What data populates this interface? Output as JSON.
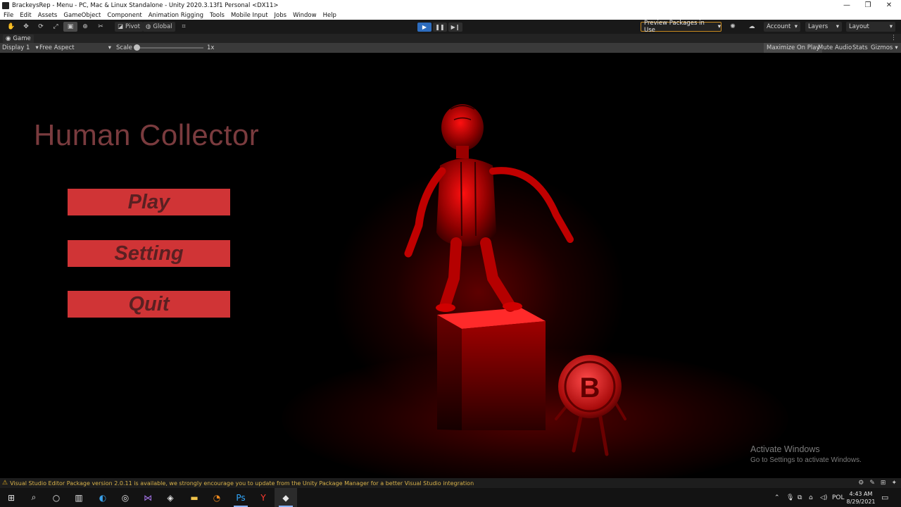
{
  "window": {
    "title": "BrackeysRep - Menu - PC, Mac & Linux Standalone - Unity 2020.3.13f1 Personal <DX11>",
    "minimize_glyph": "—",
    "restore_glyph": "❐",
    "close_glyph": "✕"
  },
  "menubar": [
    "File",
    "Edit",
    "Assets",
    "GameObject",
    "Component",
    "Animation Rigging",
    "Tools",
    "Mobile Input",
    "Jobs",
    "Window",
    "Help"
  ],
  "toolbar": {
    "pivot_label": "Pivot",
    "global_label": "Global",
    "preview_packages_label": "Preview Packages in Use",
    "account_label": "Account",
    "layers_label": "Layers",
    "layout_label": "Layout",
    "play_state": "playing"
  },
  "game_tab": {
    "label": "Game",
    "display_label": "Display 1",
    "aspect_label": "Free Aspect",
    "scale_label": "Scale",
    "scale_value": "1x",
    "maximize_label": "Maximize On Play",
    "mute_label": "Mute Audio",
    "stats_label": "Stats",
    "gizmos_label": "Gizmos"
  },
  "game": {
    "title": "Human Collector",
    "buttons": [
      "Play",
      "Setting",
      "Quit"
    ],
    "activate_title": "Activate Windows",
    "activate_subtitle": "Go to Settings to activate Windows."
  },
  "status": {
    "message": "Visual Studio Editor Package version 2.0.11 is available, we strongly encourage you to update from the Unity Package Manager for a better Visual Studio integration"
  },
  "taskbar": {
    "language": "POL",
    "time": "4:43 AM",
    "date": "8/29/2021"
  },
  "colors": {
    "button_fill": "#d03436",
    "button_text": "#5a2022",
    "title_text": "#7a3b3e",
    "play_active": "#2d6dbf"
  }
}
